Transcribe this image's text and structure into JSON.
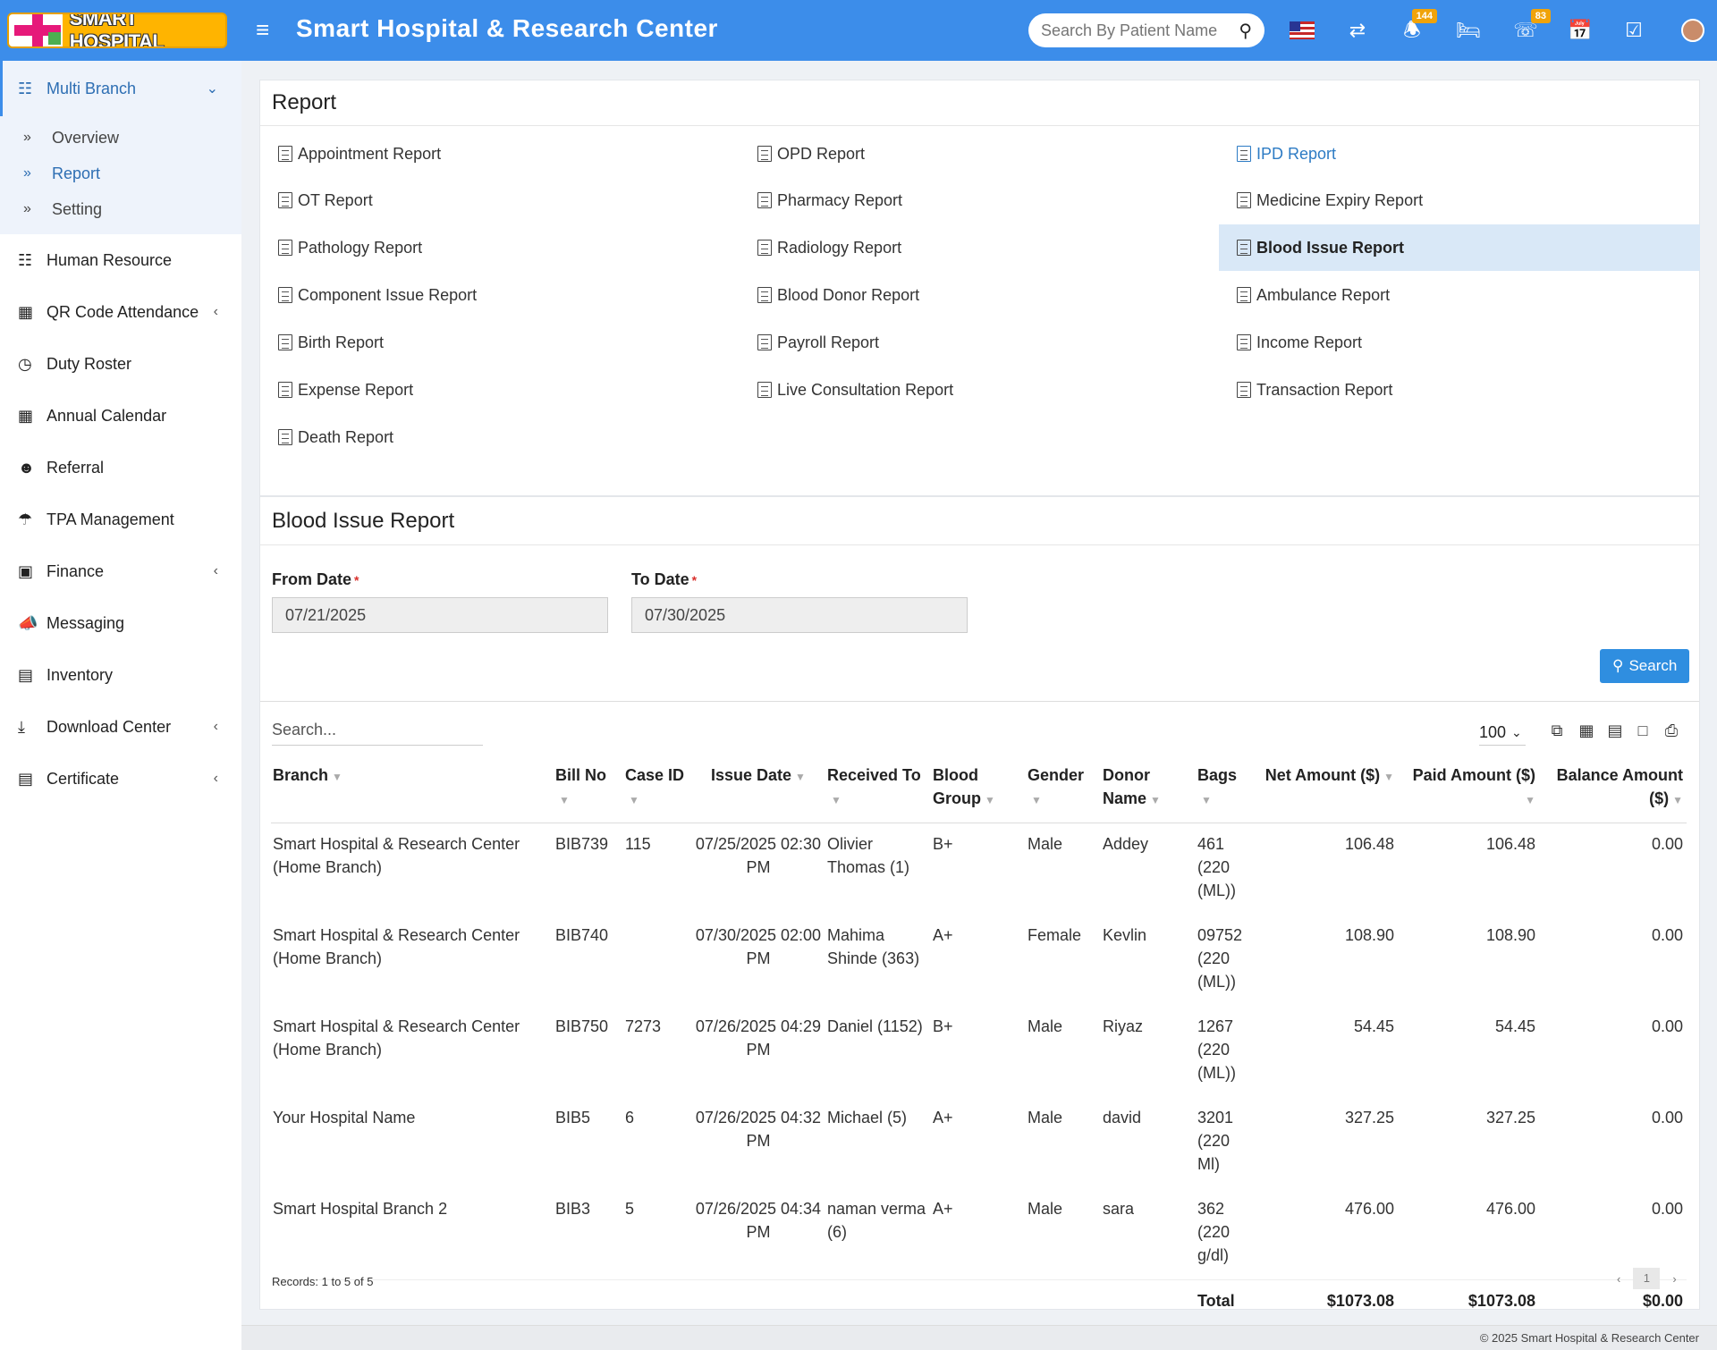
{
  "header": {
    "logo_text": "SMART HOSPITAL",
    "title": "Smart Hospital & Research Center",
    "search_placeholder": "Search By Patient Name",
    "notifications_count": "144",
    "whatsapp_count": "83"
  },
  "sidebar": {
    "multi_branch": "Multi Branch",
    "sub_items": [
      "Overview",
      "Report",
      "Setting"
    ],
    "items": [
      "Human Resource",
      "QR Code Attendance",
      "Duty Roster",
      "Annual Calendar",
      "Referral",
      "TPA Management",
      "Finance",
      "Messaging",
      "Inventory",
      "Download Center",
      "Certificate"
    ]
  },
  "reports_panel": {
    "title": "Report",
    "links": [
      "Appointment Report",
      "OPD Report",
      "IPD Report",
      "OT Report",
      "Pharmacy Report",
      "Medicine Expiry Report",
      "Pathology Report",
      "Radiology Report",
      "Blood Issue Report",
      "Component Issue Report",
      "Blood Donor Report",
      "Ambulance Report",
      "Birth Report",
      "Payroll Report",
      "Income Report",
      "Expense Report",
      "Live Consultation Report",
      "Transaction Report",
      "Death Report"
    ]
  },
  "blood_panel": {
    "title": "Blood Issue Report",
    "from_label": "From Date",
    "to_label": "To Date",
    "from_value": "07/21/2025",
    "to_value": "07/30/2025",
    "search_button": "Search"
  },
  "table": {
    "search_placeholder": "Search...",
    "page_size": "100",
    "columns": [
      "Branch",
      "Bill No",
      "Case ID",
      "Issue Date",
      "Received To",
      "Blood Group",
      "Gender",
      "Donor Name",
      "Bags",
      "Net Amount ($)",
      "Paid Amount ($)",
      "Balance Amount ($)"
    ],
    "rows": [
      [
        "Smart Hospital & Research Center (Home Branch)",
        "BIB739",
        "115",
        "07/25/2025 02:30 PM",
        "Olivier Thomas (1)",
        "B+",
        "Male",
        "Addey",
        "461 (220 (ML))",
        "106.48",
        "106.48",
        "0.00"
      ],
      [
        "Smart Hospital & Research Center (Home Branch)",
        "BIB740",
        "",
        "07/30/2025 02:00 PM",
        "Mahima Shinde (363)",
        "A+",
        "Female",
        "Kevlin",
        "09752 (220 (ML))",
        "108.90",
        "108.90",
        "0.00"
      ],
      [
        "Smart Hospital & Research Center (Home Branch)",
        "BIB750",
        "7273",
        "07/26/2025 04:29 PM",
        "Daniel (1152)",
        "B+",
        "Male",
        "Riyaz",
        "1267 (220 (ML))",
        "54.45",
        "54.45",
        "0.00"
      ],
      [
        "Your Hospital Name",
        "BIB5",
        "6",
        "07/26/2025 04:32 PM",
        "Michael (5)",
        "A+",
        "Male",
        "david",
        "3201 (220 Ml)",
        "327.25",
        "327.25",
        "0.00"
      ],
      [
        "Smart Hospital Branch 2",
        "BIB3",
        "5",
        "07/26/2025 04:34 PM",
        "naman verma (6)",
        "A+",
        "Male",
        "sara",
        "362 (220 g/dl)",
        "476.00",
        "476.00",
        "0.00"
      ]
    ],
    "total_label": "Total",
    "total_net": "$1073.08",
    "total_paid": "$1073.08",
    "total_balance": "$0.00",
    "records_text": "Records: 1 to 5 of 5",
    "current_page": "1"
  },
  "footer": {
    "text": "© 2025 Smart Hospital & Research Center"
  },
  "colors": {
    "header_bg": "#3c8dea",
    "accent": "#2f8ee0",
    "selected_row": "#d9e8f7",
    "badge": "#f0a30a"
  }
}
